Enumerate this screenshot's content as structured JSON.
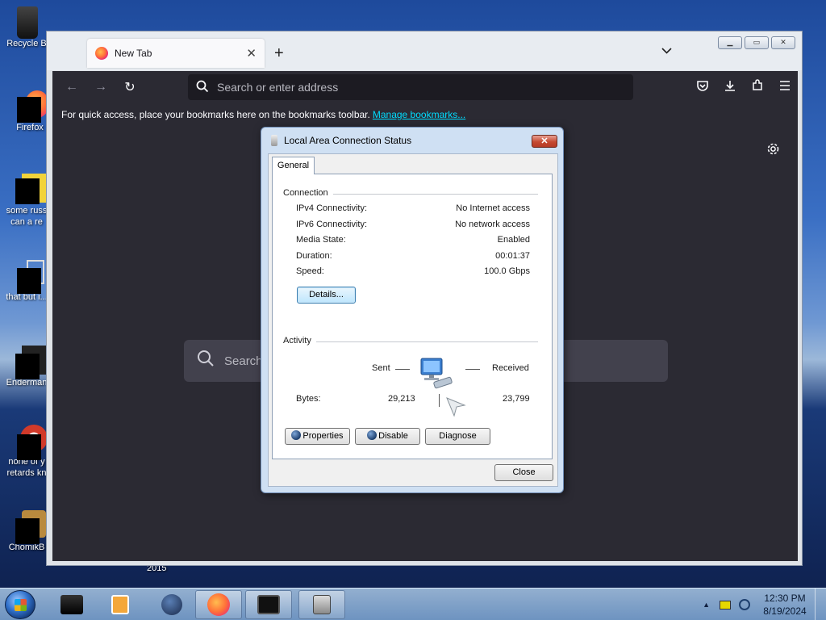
{
  "desktop": {
    "icons": [
      {
        "label": "Recycle Bin",
        "display": "Recycle B"
      },
      {
        "label": "Firefox",
        "display": "Firefox"
      },
      {
        "label": "some russ... can a re...",
        "display": "some russ\ncan a re"
      },
      {
        "label": "that but i...",
        "display": "that but i..."
      },
      {
        "label": "Enderman...",
        "display": "Enderman"
      },
      {
        "label": "none of y... retards kn...",
        "display": "none of y\nretards kn"
      },
      {
        "label": "ChomikB...",
        "display": "ChomikB"
      }
    ],
    "year_label": "2015"
  },
  "browser": {
    "tab_title": "New Tab",
    "tab_close": "✕",
    "new_tab": "+",
    "list_tabs": "⌄",
    "url_placeholder": "Search or enter address",
    "bookmarks_text": "For quick access, place your bookmarks here on the bookmarks toolbar.",
    "manage_bookmarks": "Manage bookmarks...",
    "search_placeholder": "Search"
  },
  "window_controls": {
    "minimize": "▁",
    "maximize": "▭",
    "close": "✕"
  },
  "dialog": {
    "title": "Local Area Connection Status",
    "close": "✕",
    "tab": "General",
    "connection_label": "Connection",
    "rows": [
      {
        "key": "IPv4 Connectivity:",
        "value": "No Internet access"
      },
      {
        "key": "IPv6 Connectivity:",
        "value": "No network access"
      },
      {
        "key": "Media State:",
        "value": "Enabled"
      },
      {
        "key": "Duration:",
        "value": "00:01:37"
      },
      {
        "key": "Speed:",
        "value": "100.0 Gbps"
      }
    ],
    "details_button": "Details...",
    "activity_label": "Activity",
    "sent_label": "Sent",
    "received_label": "Received",
    "bytes_label": "Bytes:",
    "bytes_sent": "29,213",
    "bytes_received": "23,799",
    "properties_button": "Properties",
    "disable_button": "Disable",
    "diagnose_button": "Diagnose",
    "close_button": "Close"
  },
  "taskbar": {
    "time": "12:30 PM",
    "date": "8/19/2024"
  }
}
